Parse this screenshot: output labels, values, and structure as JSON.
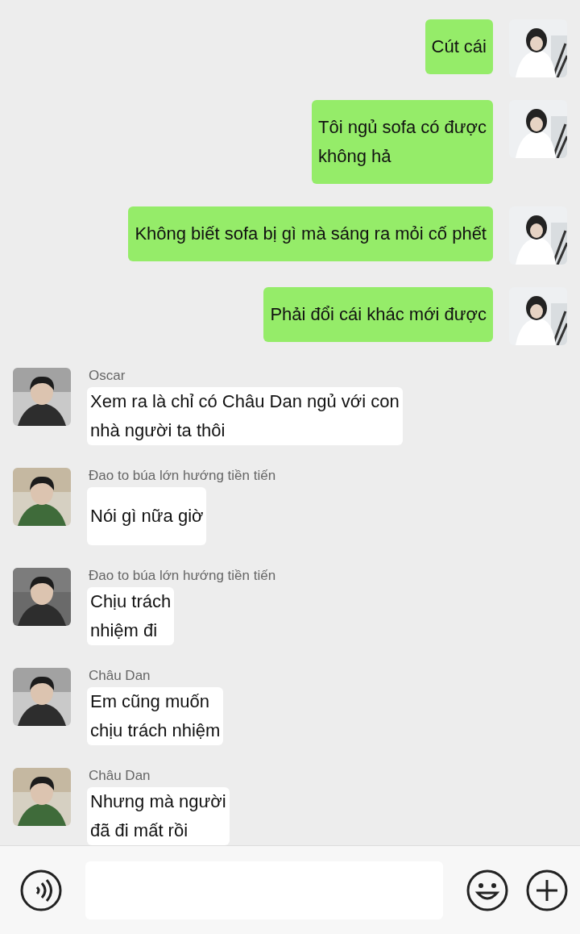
{
  "messages": [
    {
      "kind": "outgoing",
      "text": "Cút cái"
    },
    {
      "kind": "outgoing",
      "text": "Tôi ngủ sofa có được\nkhông hả"
    },
    {
      "kind": "outgoing",
      "text": "Không biết sofa bị gì mà sáng ra mỏi cố phết"
    },
    {
      "kind": "outgoing",
      "text": "Phải đổi cái khác mới được"
    },
    {
      "kind": "incoming",
      "sender": "Oscar",
      "text": "Xem ra là chỉ có Châu Dan ngủ với con\nnhà người ta thôi"
    },
    {
      "kind": "incoming",
      "sender": "Đao to búa lớn hướng tiền tiến",
      "text": "Nói gì nữa giờ"
    },
    {
      "kind": "incoming",
      "sender": "Đao to búa lớn hướng tiền tiến",
      "text": "Chịu trách\nnhiệm đi"
    },
    {
      "kind": "incoming",
      "sender": "Châu Dan",
      "text": "Em cũng muốn\nchịu trách nhiệm"
    },
    {
      "kind": "incoming",
      "sender": "Châu Dan",
      "text": "Nhưng mà người\nđã đi mất rồi"
    }
  ]
}
